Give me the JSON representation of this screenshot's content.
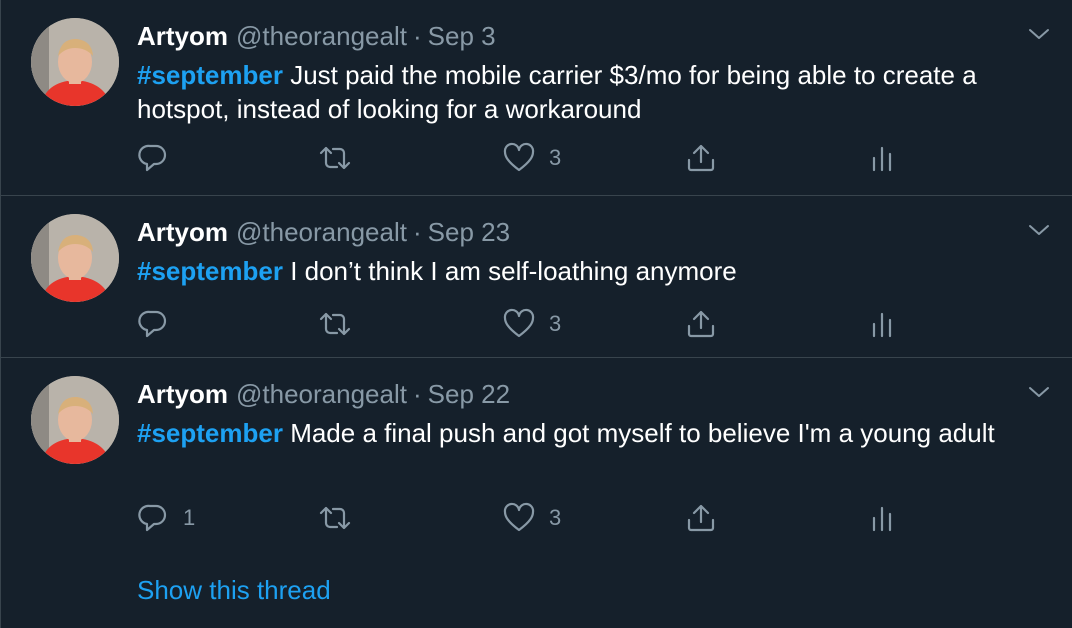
{
  "tweets": [
    {
      "name": "Artyom",
      "handle": "@theorangealt",
      "separator": "·",
      "date": "Sep 3",
      "hashtag": "#september",
      "text": " Just paid the mobile carrier $3/mo for being able to create a hotspot, instead of looking for a workaround",
      "reply_count": "",
      "like_count": "3"
    },
    {
      "name": "Artyom",
      "handle": "@theorangealt",
      "separator": "·",
      "date": "Sep 23",
      "hashtag": "#september",
      "text": " I don’t think I am self-loathing anymore",
      "reply_count": "",
      "like_count": "3"
    },
    {
      "name": "Artyom",
      "handle": "@theorangealt",
      "separator": "·",
      "date": "Sep 22",
      "hashtag": "#september",
      "text": " Made a final push and got myself to believe I'm a young adult",
      "reply_count": "1",
      "like_count": "3"
    }
  ],
  "show_thread_label": "Show this thread",
  "colors": {
    "background": "#15202b",
    "border": "#38444d",
    "accent": "#1da1f2",
    "muted": "#8899a6",
    "text": "#ffffff"
  },
  "icons": [
    "chevron-down-icon",
    "reply-icon",
    "retweet-icon",
    "like-icon",
    "share-icon",
    "analytics-icon"
  ]
}
